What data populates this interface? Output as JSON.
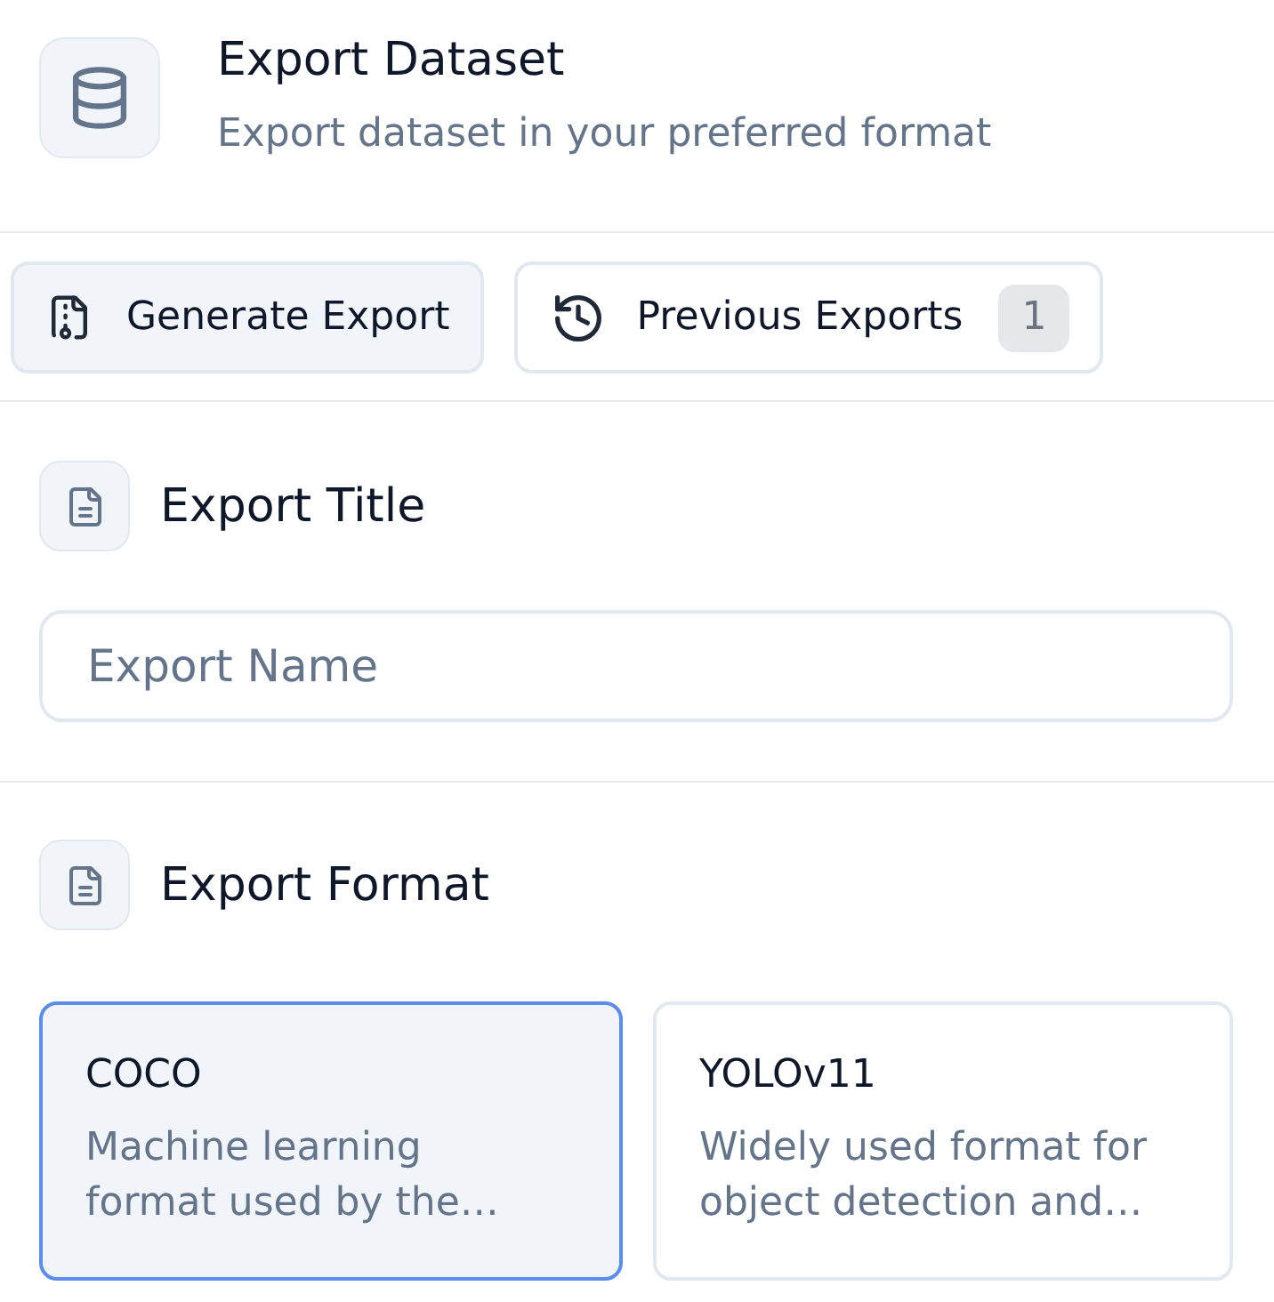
{
  "header": {
    "title": "Export Dataset",
    "subtitle": "Export dataset in your preferred format"
  },
  "tabs": [
    {
      "label": "Generate Export",
      "selected": true
    },
    {
      "label": "Previous Exports",
      "selected": false,
      "badge": "1"
    }
  ],
  "sections": [
    {
      "kind": "input",
      "title": "Export Title",
      "placeholder": "Export Name"
    },
    {
      "kind": "options",
      "title": "Export Format",
      "options": [
        {
          "title": "COCO",
          "description": "Machine learning format used by the…",
          "selected": true
        },
        {
          "title": "YOLOv11",
          "description": "Widely used format for object detection and…",
          "selected": false
        }
      ]
    }
  ]
}
